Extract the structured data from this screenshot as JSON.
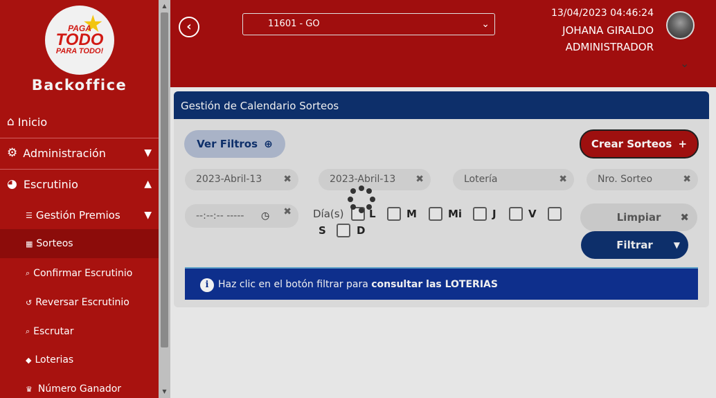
{
  "brand": {
    "logo_line1": "PAGA",
    "logo_line2": "TODO",
    "logo_line3": "PARA TODO!",
    "name": "Backoffice"
  },
  "sidebar": {
    "items": [
      {
        "label": "Inicio",
        "icon": "home-icon"
      },
      {
        "label": "Administración",
        "icon": "gear-icon"
      },
      {
        "label": "Escrutinio",
        "icon": "pie-chart-icon"
      },
      {
        "label": "Gestión Premios",
        "icon": "sliders-icon"
      },
      {
        "label": "Sorteos",
        "icon": "calendar-icon"
      },
      {
        "label": "Confirmar Escrutinio",
        "icon": "search-icon"
      },
      {
        "label": "Reversar Escrutinio",
        "icon": "undo-icon"
      },
      {
        "label": "Escrutar",
        "icon": "search-icon"
      },
      {
        "label": "Loterias",
        "icon": "ticket-icon"
      },
      {
        "label": "Número Ganador",
        "icon": "trophy-icon"
      }
    ]
  },
  "header": {
    "branch": "11601 - GO",
    "datetime": "13/04/2023 04:46:24",
    "user_name": "JOHANA GIRALDO",
    "user_role": "ADMINISTRADOR"
  },
  "main": {
    "title": "Gestión de Calendario Sorteos",
    "ver_filtros": "Ver Filtros",
    "crear_sorteos": "Crear Sorteos",
    "date_from": "2023-Abril-13",
    "date_to": "2023-Abril-13",
    "loteria_placeholder": "Lotería",
    "nro_sorteo_placeholder": "Nro. Sorteo",
    "time_placeholder": "--:--:-- -----",
    "days_label": "Día(s)",
    "days": [
      "L",
      "M",
      "Mi",
      "J",
      "V",
      "S",
      "D"
    ],
    "limpiar": "Limpiar",
    "filtrar": "Filtrar",
    "alert_text": "Haz clic en el botón filtrar para ",
    "alert_bold": "consultar las LOTERIAS"
  },
  "colors": {
    "primary_red": "#a00e0e",
    "navy": "#0d2f6a",
    "alert_blue": "#0e2f8c"
  }
}
